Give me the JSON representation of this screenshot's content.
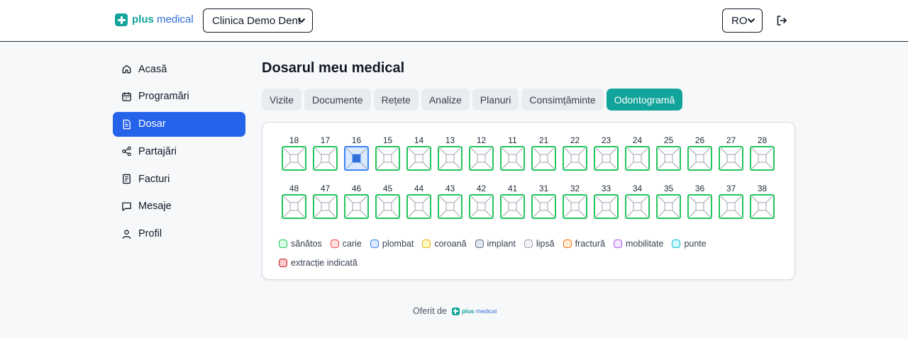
{
  "header": {
    "logo_part1": "plus",
    "logo_part2": "medical",
    "clinic_selected": "Clinica Demo Dent",
    "language_selected": "RO"
  },
  "sidebar": {
    "items": [
      {
        "label": "Acasă",
        "icon": "home-icon",
        "active": false
      },
      {
        "label": "Programări",
        "icon": "calendar-icon",
        "active": false
      },
      {
        "label": "Dosar",
        "icon": "file-icon",
        "active": true
      },
      {
        "label": "Partajări",
        "icon": "share-icon",
        "active": false
      },
      {
        "label": "Facturi",
        "icon": "invoice-icon",
        "active": false
      },
      {
        "label": "Mesaje",
        "icon": "message-icon",
        "active": false
      },
      {
        "label": "Profil",
        "icon": "user-icon",
        "active": false
      }
    ]
  },
  "main": {
    "title": "Dosarul meu medical",
    "tabs": [
      {
        "label": "Vizite",
        "active": false
      },
      {
        "label": "Documente",
        "active": false
      },
      {
        "label": "Rețete",
        "active": false
      },
      {
        "label": "Analize",
        "active": false
      },
      {
        "label": "Planuri",
        "active": false
      },
      {
        "label": "Consimțăminte",
        "active": false
      },
      {
        "label": "Odontogramă",
        "active": true
      }
    ]
  },
  "odontogram": {
    "upper_row": [
      {
        "number": "18",
        "status": "sănătos"
      },
      {
        "number": "17",
        "status": "sănătos"
      },
      {
        "number": "16",
        "status": "plombat"
      },
      {
        "number": "15",
        "status": "sănătos"
      },
      {
        "number": "14",
        "status": "sănătos"
      },
      {
        "number": "13",
        "status": "sănătos"
      },
      {
        "number": "12",
        "status": "sănătos"
      },
      {
        "number": "11",
        "status": "sănătos"
      },
      {
        "number": "21",
        "status": "sănătos"
      },
      {
        "number": "22",
        "status": "sănătos"
      },
      {
        "number": "23",
        "status": "sănătos"
      },
      {
        "number": "24",
        "status": "sănătos"
      },
      {
        "number": "25",
        "status": "sănătos"
      },
      {
        "number": "26",
        "status": "sănătos"
      },
      {
        "number": "27",
        "status": "sănătos"
      },
      {
        "number": "28",
        "status": "sănătos"
      }
    ],
    "lower_row": [
      {
        "number": "48",
        "status": "sănătos"
      },
      {
        "number": "47",
        "status": "sănătos"
      },
      {
        "number": "46",
        "status": "sănătos"
      },
      {
        "number": "45",
        "status": "sănătos"
      },
      {
        "number": "44",
        "status": "sănătos"
      },
      {
        "number": "43",
        "status": "sănătos"
      },
      {
        "number": "42",
        "status": "sănătos"
      },
      {
        "number": "41",
        "status": "sănătos"
      },
      {
        "number": "31",
        "status": "sănătos"
      },
      {
        "number": "32",
        "status": "sănătos"
      },
      {
        "number": "33",
        "status": "sănătos"
      },
      {
        "number": "34",
        "status": "sănătos"
      },
      {
        "number": "35",
        "status": "sănătos"
      },
      {
        "number": "36",
        "status": "sănătos"
      },
      {
        "number": "37",
        "status": "sănătos"
      },
      {
        "number": "38",
        "status": "sănătos"
      }
    ],
    "legend": [
      {
        "label": "sănătos",
        "border": "#22c55e",
        "fill": "#dcfce7"
      },
      {
        "label": "carie",
        "border": "#ef4444",
        "fill": "#fee2e2"
      },
      {
        "label": "plombat",
        "border": "#3b82f6",
        "fill": "#dbeafe"
      },
      {
        "label": "coroană",
        "border": "#eab308",
        "fill": "#fef9c3"
      },
      {
        "label": "implant",
        "border": "#64748b",
        "fill": "#e2e8f0"
      },
      {
        "label": "lipsă",
        "border": "#9ca3af",
        "fill": "#f3f4f6"
      },
      {
        "label": "fractură",
        "border": "#f97316",
        "fill": "#ffedd5"
      },
      {
        "label": "mobilitate",
        "border": "#a855f7",
        "fill": "#f3e8ff"
      },
      {
        "label": "punte",
        "border": "#06b6d4",
        "fill": "#cffafe"
      },
      {
        "label": "extracție indicată",
        "border": "#b91c1c",
        "fill": "#fecaca"
      }
    ]
  },
  "footer": {
    "offered_by": "Oferit de",
    "logo_part1": "plus",
    "logo_part2": "medical"
  },
  "colors": {
    "accent": "#12a49a",
    "primary": "#2563eb",
    "healthy_border": "#22c55e",
    "filled_border": "#3b82f6",
    "filled_fill": "#dbeafe",
    "filled_center": "#2f6fd6"
  }
}
